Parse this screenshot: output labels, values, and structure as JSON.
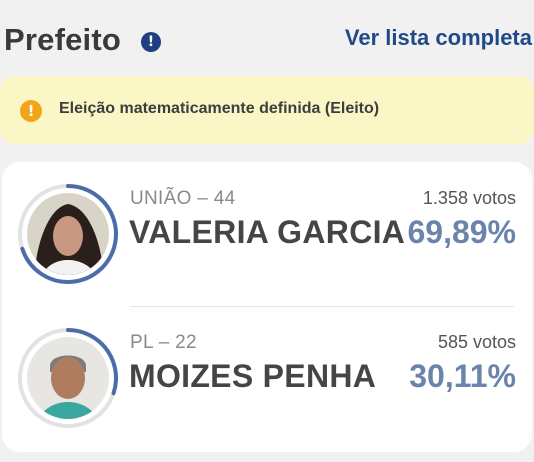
{
  "header": {
    "title": "Prefeito",
    "info_icon": "info-icon",
    "info_glyph": "!",
    "full_list_link": "Ver lista completa"
  },
  "alert": {
    "icon": "warning-icon",
    "icon_glyph": "!",
    "text": "Eleição matematicamente definida (Eleito)"
  },
  "candidates": [
    {
      "party": "UNIÃO – 44",
      "name": "VALERIA GARCIA",
      "votes": "1.358 votos",
      "percent": "69,89%",
      "share": 0.6989
    },
    {
      "party": "PL – 22",
      "name": "MOIZES PENHA",
      "votes": "585 votos",
      "percent": "30,11%",
      "share": 0.3011
    }
  ],
  "colors": {
    "accent": "#1f4a8a",
    "ring_track": "#e2e2e2",
    "ring_fill": "#4a6daa",
    "percent": "#6c84ab",
    "alert_bg": "#fbf6c6",
    "alert_icon": "#f2a516"
  }
}
